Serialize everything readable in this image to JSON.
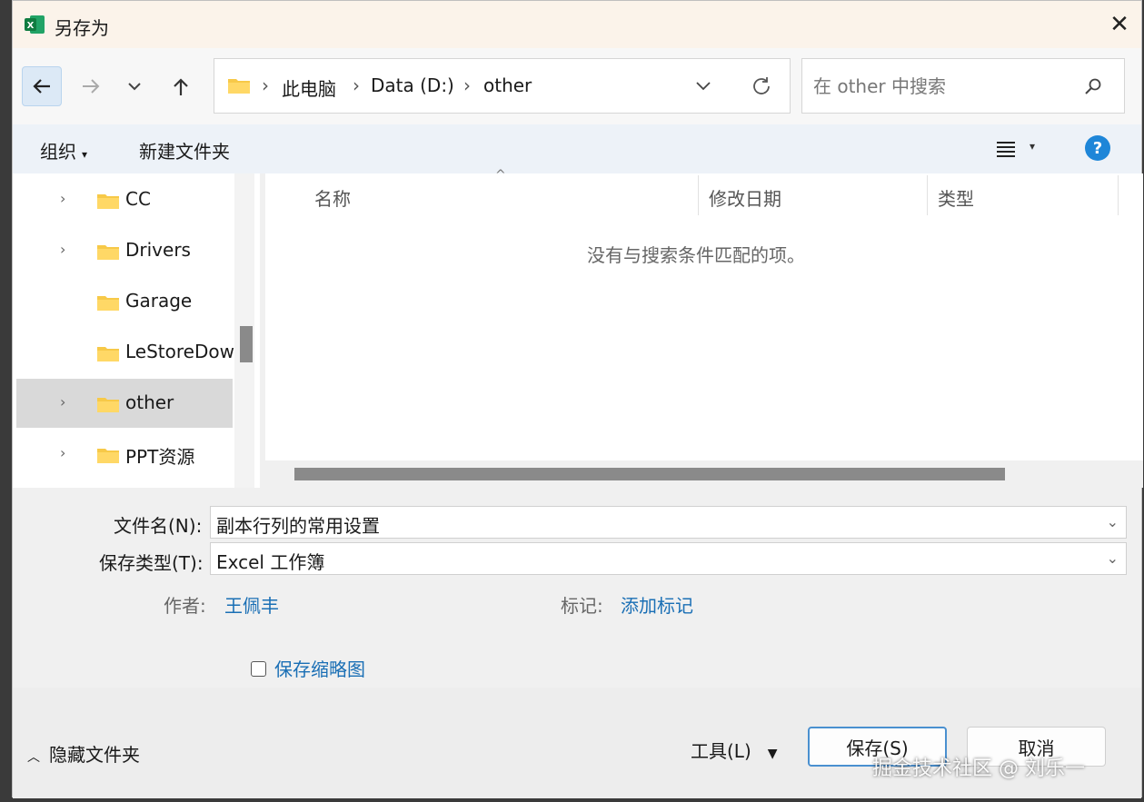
{
  "window": {
    "title": "另存为"
  },
  "nav": {
    "path": [
      "此电脑",
      "Data (D:)",
      "other"
    ],
    "search_placeholder": "在 other 中搜索"
  },
  "toolbar": {
    "organize_label": "组织",
    "new_folder_label": "新建文件夹"
  },
  "sidebar": {
    "items": [
      {
        "label": "CC"
      },
      {
        "label": "Drivers"
      },
      {
        "label": "Garage"
      },
      {
        "label": "LeStoreDow"
      },
      {
        "label": "other"
      },
      {
        "label": "PPT资源"
      }
    ]
  },
  "file_list": {
    "columns": [
      "名称",
      "修改日期",
      "类型"
    ],
    "empty_message": "没有与搜索条件匹配的项。"
  },
  "form": {
    "filename_label": "文件名(N):",
    "filename_value": "副本行列的常用设置",
    "filetype_label": "保存类型(T):",
    "filetype_value": "Excel 工作簿",
    "author_label": "作者:",
    "author_value": "王佩丰",
    "tags_label": "标记:",
    "tags_value": "添加标记",
    "thumbnail_label": "保存缩略图"
  },
  "footer": {
    "hide_folders_label": "隐藏文件夹",
    "tools_label": "工具(L)",
    "save_label": "保存(S)",
    "cancel_label": "取消"
  },
  "watermark": "掘金技术社区 @ 刘乐一",
  "colors": {
    "accent": "#1e86d8",
    "link": "#1a6fb5",
    "selected": "#d9d9d9",
    "excel_green": "#1e7145"
  }
}
